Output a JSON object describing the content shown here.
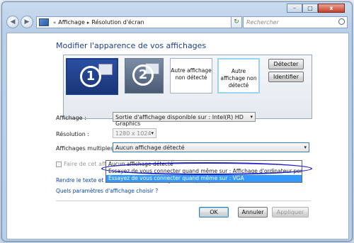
{
  "titlebar": {
    "minimize": "–",
    "maximize": "□",
    "close": "x"
  },
  "nav": {
    "back": "◀",
    "forward": "▶",
    "refresh": "↻"
  },
  "breadcrumb": {
    "prefix": "«",
    "items": [
      "Affichage",
      "Résolution d'écran"
    ],
    "separator": "▸"
  },
  "search": {
    "placeholder": "Rechercher"
  },
  "page": {
    "title": "Modifier l'apparence de vos affichages"
  },
  "monitors": {
    "monitor1_number": "1",
    "monitor2_number": "2",
    "monitor3_label": "Autre affichage non détecté",
    "monitor4_label": "Autre affichage non détecté"
  },
  "buttons": {
    "detect": "Détecter",
    "identify": "Identifier",
    "ok": "OK",
    "cancel": "Annuler",
    "apply": "Appliquer"
  },
  "fields": {
    "display_label": "Affichage :",
    "display_value": "Sortie d'affichage disponible sur : Intel(R) HD Graphics",
    "resolution_label": "Résolution :",
    "resolution_value": "1280 x 1024",
    "multiple_label": "Affichages multiples :",
    "multiple_value": "Aucun affichage détecté"
  },
  "dropdown": {
    "options": [
      "Aucun affichage détecté",
      "Essayez de vous connecter quand même sur : Affichage d'ordinateur portable",
      "Essayez de vous connecter quand même sur : VGA"
    ],
    "selected_index": 2
  },
  "checkbox": {
    "label": "Faire de cet affichage"
  },
  "links": {
    "text_size": "Rendre le texte et d'autres éléments plus grands ou plus petits",
    "which_settings": "Quels paramètres d'affichage choisir ?"
  },
  "colors": {
    "title": "#1e3f8a",
    "link": "#0d47a1",
    "selection": "#3399ff",
    "annotation": "#2020c0"
  }
}
